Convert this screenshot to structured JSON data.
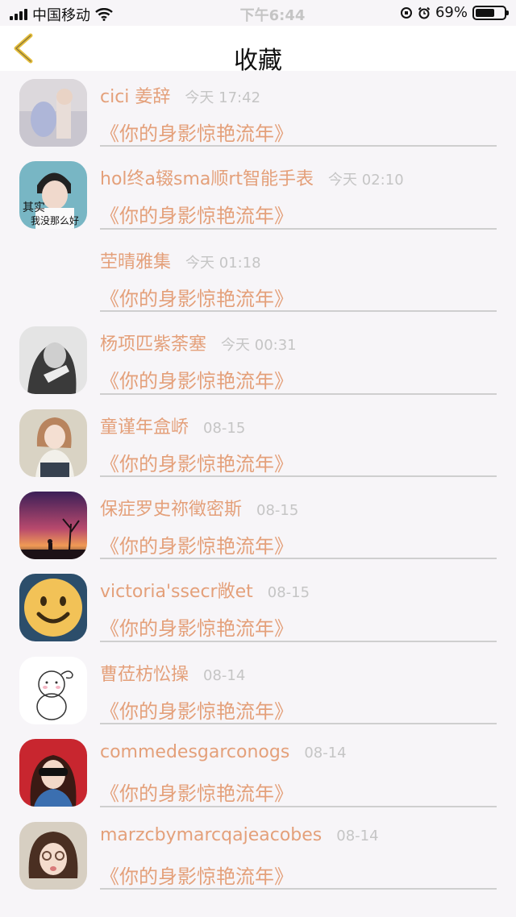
{
  "status": {
    "carrier": "中国移动",
    "time": "下午6:44",
    "battery": "69%",
    "battery_level": 0.69
  },
  "header": {
    "title": "收藏",
    "back_icon": "chevron-left-icon"
  },
  "colors": {
    "accent": "#e4a07a",
    "timestamp": "#c5c5c5",
    "divider": "#cfcfcf",
    "back": "#e6bf3d"
  },
  "items": [
    {
      "name": "cici 姜辞",
      "time": "今天 17:42",
      "subject": "《你的身影惊艳流年》",
      "avatar": "avatar-unicorn-figure"
    },
    {
      "name": "hol终a辍sma顺rt智能手表",
      "time": "今天 02:10",
      "subject": "《你的身影惊艳流年》",
      "avatar": "avatar-boy-caption"
    },
    {
      "name": "茔晴雅集",
      "time": "今天 01:18",
      "subject": "《你的身影惊艳流年》",
      "avatar": ""
    },
    {
      "name": "杨项匹紫荼塞",
      "time": "今天 00:31",
      "subject": "《你的身影惊艳流年》",
      "avatar": "avatar-grayscale-portrait"
    },
    {
      "name": "童谨年盒峤",
      "time": "08-15",
      "subject": "《你的身影惊艳流年》",
      "avatar": "avatar-girl-scarf"
    },
    {
      "name": "保症罗史祢徵密斯",
      "time": "08-15",
      "subject": "《你的身影惊艳流年》",
      "avatar": "avatar-sunset-silhouette"
    },
    {
      "name": "victoria'ssecr敞et",
      "time": "08-15",
      "subject": "《你的身影惊艳流年》",
      "avatar": "avatar-smiley-cookie"
    },
    {
      "name": "曹莅枋忪操",
      "time": "08-14",
      "subject": "《你的身影惊艳流年》",
      "avatar": "avatar-cartoon-doodle"
    },
    {
      "name": "commedesgarconogs",
      "time": "08-14",
      "subject": "《你的身影惊艳流年》",
      "avatar": "avatar-sunglasses-girl"
    },
    {
      "name": "marzcbymarcqajeacobes",
      "time": "08-14",
      "subject": "《你的身影惊艳流年》",
      "avatar": "avatar-girl-hands"
    }
  ]
}
